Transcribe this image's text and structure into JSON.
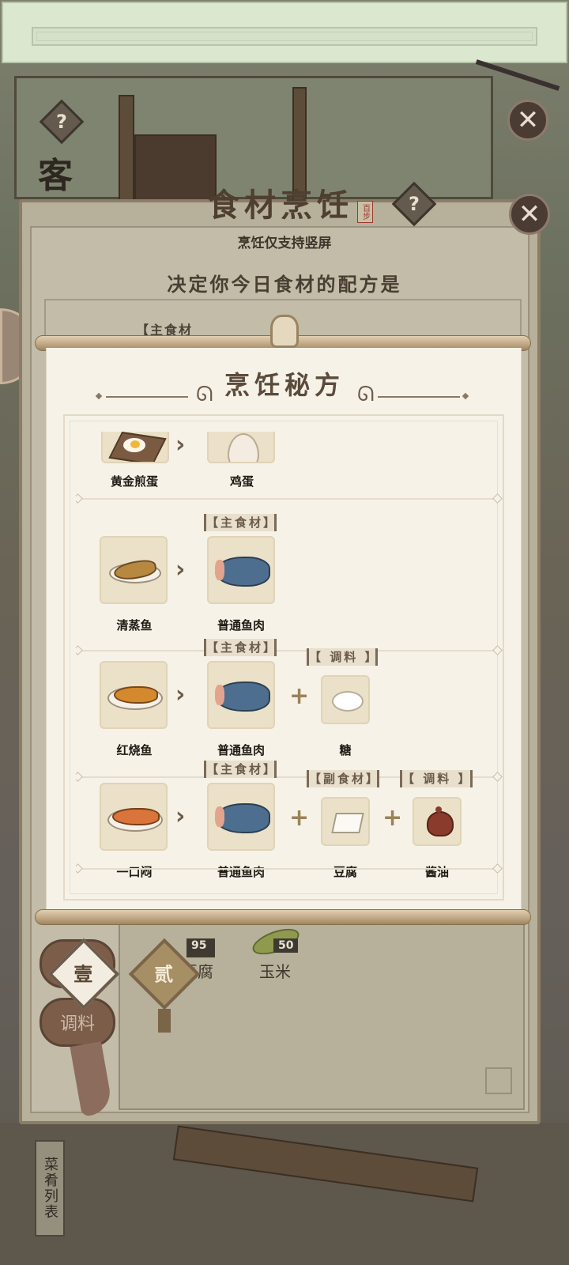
{
  "background": {
    "left_partial_label": "客"
  },
  "cook_panel": {
    "title": "食材烹饪",
    "seal_text": "百步",
    "portrait_note": "烹饪仅支持竖屏",
    "question": "决定你今日食材的配方是",
    "hidden_tag": "【主食材",
    "inventory": [
      {
        "count": "95",
        "name": "豆腐"
      },
      {
        "count": "50",
        "name": "玉米"
      }
    ],
    "side_buttons": [
      "副",
      "调料"
    ],
    "tabs": [
      {
        "label": "壹",
        "selected": true
      },
      {
        "label": "贰",
        "selected": false
      }
    ],
    "menu_list_label": "菜肴列表"
  },
  "popup": {
    "title": "烹饪秘方",
    "recipes": [
      {
        "dish": "黄金煎蛋",
        "ingredients": [
          {
            "tag": "",
            "name": "鸡蛋"
          }
        ]
      },
      {
        "dish": "清蒸鱼",
        "ingredients": [
          {
            "tag": "【主食材】",
            "name": "普通鱼肉"
          }
        ]
      },
      {
        "dish": "红烧鱼",
        "ingredients": [
          {
            "tag": "【主食材】",
            "name": "普通鱼肉"
          },
          {
            "tag": "【 调料 】",
            "name": "糖"
          }
        ]
      },
      {
        "dish": "一口闷",
        "ingredients": [
          {
            "tag": "【主食材】",
            "name": "普通鱼肉"
          },
          {
            "tag": "【副食材】",
            "name": "豆腐"
          },
          {
            "tag": "【 调料 】",
            "name": "酱油"
          }
        ]
      }
    ]
  },
  "colors": {
    "popup_paper": "#f6f2e8",
    "accent_brown": "#5c4b3c",
    "plus_gold": "#9b8257"
  },
  "icons": {
    "help": "?",
    "close": "✕",
    "chevron": "›",
    "plus": "+"
  }
}
